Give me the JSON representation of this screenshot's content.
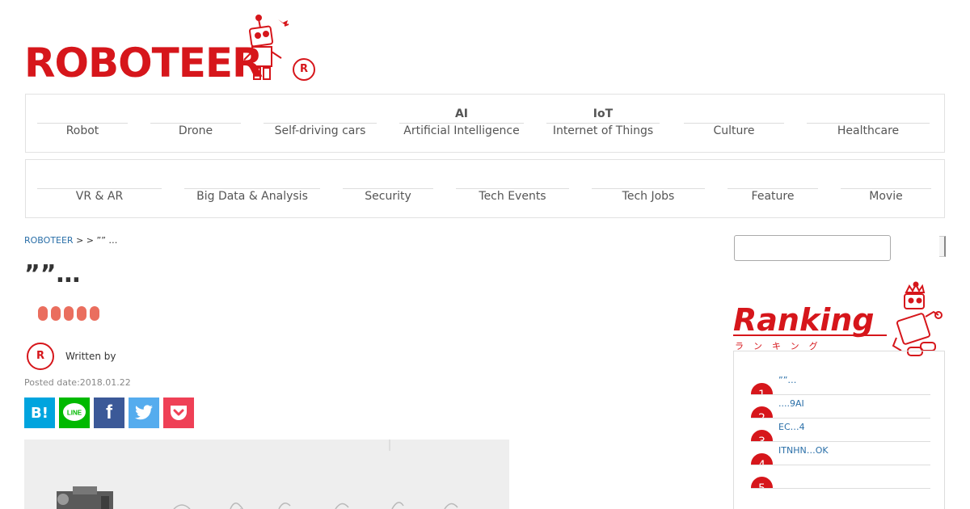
{
  "brand": {
    "logo_text": "ROBOTEER",
    "accent": "#d6161b"
  },
  "nav_primary": [
    {
      "label": "Robot",
      "sub": ""
    },
    {
      "label": "Drone",
      "sub": ""
    },
    {
      "label": "Self-driving cars",
      "sub": ""
    },
    {
      "label": "Artificial Intelligence",
      "sub": "AI"
    },
    {
      "label": "Internet of Things",
      "sub": "IoT"
    },
    {
      "label": "Culture",
      "sub": ""
    },
    {
      "label": "Healthcare",
      "sub": ""
    }
  ],
  "nav_secondary": [
    {
      "label": "VR & AR"
    },
    {
      "label": "Big Data & Analysis"
    },
    {
      "label": "Security"
    },
    {
      "label": "Tech Events"
    },
    {
      "label": "Tech Jobs"
    },
    {
      "label": "Feature"
    },
    {
      "label": "Movie"
    }
  ],
  "breadcrumb": {
    "home": "ROBOTEER",
    "sep1": ">",
    "sep2": ">",
    "current": "”” …"
  },
  "article": {
    "title": "””…",
    "written_by": "Written by",
    "posted_date": "Posted date:2018.01.22"
  },
  "share": {
    "hatena": "B!",
    "line": "LINE",
    "facebook": "f",
    "twitter": "twitter-bird-icon",
    "pocket": "pocket-icon"
  },
  "sidebar": {
    "search_placeholder": "",
    "ranking_title": "Ranking",
    "ranking_kana": "ランキング",
    "ranking": [
      {
        "rank": "1",
        "title": "””…"
      },
      {
        "rank": "2",
        "title": "....9AI"
      },
      {
        "rank": "3",
        "title": "EC…4"
      },
      {
        "rank": "4",
        "title": "ITNHN…OK"
      },
      {
        "rank": "5",
        "title": ""
      }
    ]
  }
}
